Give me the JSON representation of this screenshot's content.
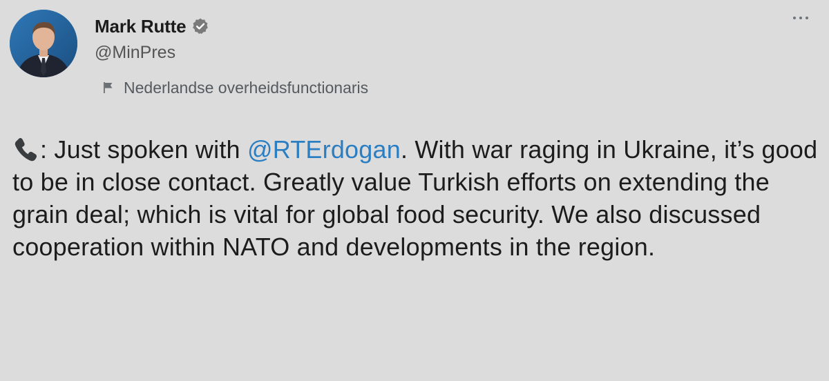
{
  "author": {
    "display_name": "Mark Rutte",
    "handle": "@MinPres",
    "verified": true,
    "avatar_icon": "profile-photo"
  },
  "label": {
    "icon": "flag-icon",
    "text": "Nederlandse overheidsfunctionaris"
  },
  "tweet": {
    "prefix_icon": "telephone-receiver-emoji",
    "text_before_mention": ": Just spoken with ",
    "mention": "@RTErdogan",
    "text_after_mention": ". With war raging in Ukraine, it’s good to be in close contact. Greatly value Turkish efforts on extending the grain deal; which is vital for global food security. We also discussed cooperation within NATO and developments in the region."
  },
  "colors": {
    "background": "#dcdcdc",
    "mention": "#2b7ec2",
    "verified_badge": "#7a7a7a",
    "secondary_text": "#545454"
  }
}
